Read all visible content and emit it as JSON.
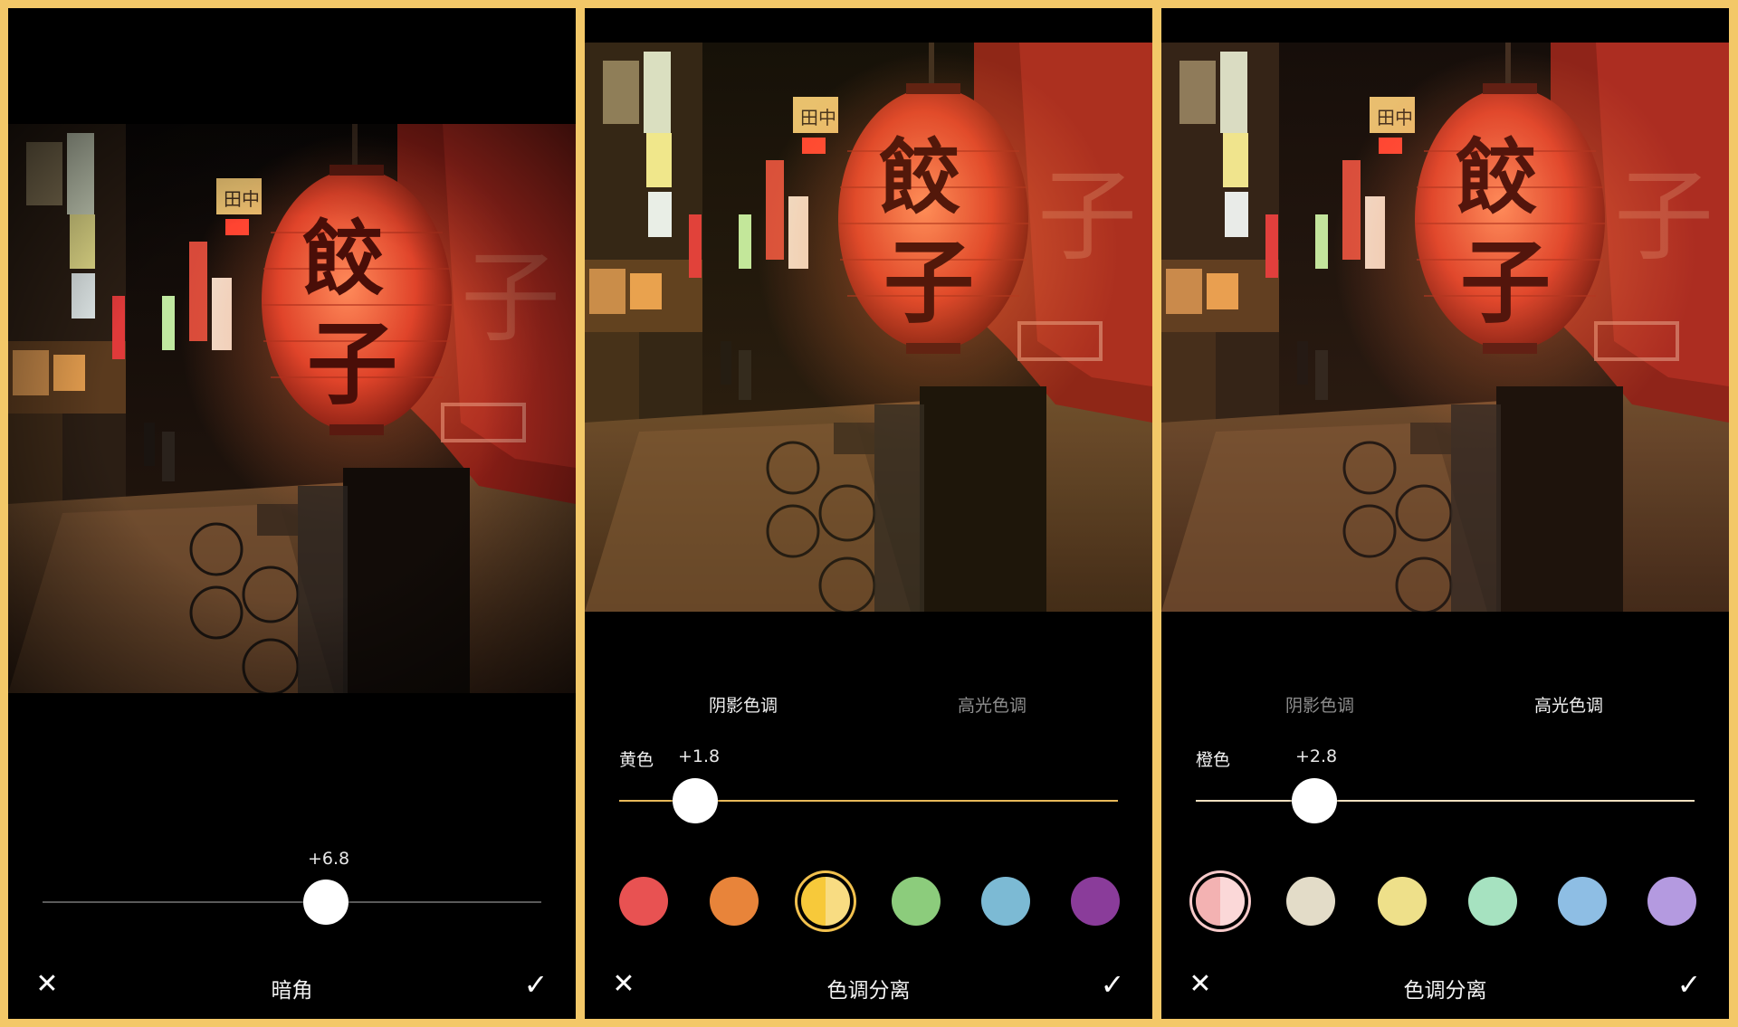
{
  "panels": [
    {
      "tool_title": "暗角",
      "value": "+6.8",
      "slider_fraction": 0.58,
      "close_icon": "✕",
      "confirm_icon": "✓"
    },
    {
      "tab_shadow": "阴影色调",
      "tab_highlight": "高光色调",
      "active_tab": "shadow",
      "color_label": "黄色",
      "value": "+1.8",
      "slider_fraction": 0.155,
      "swatches": [
        "#e85252",
        "#e8843a",
        "#f7c93a",
        "#8ccc7c",
        "#7cbad4",
        "#8a3c9a"
      ],
      "swatch_selected": 2,
      "selected_color": "#f2c14e",
      "tool_title": "色调分离",
      "close_icon": "✕",
      "confirm_icon": "✓"
    },
    {
      "tab_shadow": "阴影色调",
      "tab_highlight": "高光色调",
      "active_tab": "highlight",
      "color_label": "橙色",
      "value": "+2.8",
      "slider_fraction": 0.24,
      "swatches": [
        "#f3b2b2",
        "#e3dcc8",
        "#eee08a",
        "#a6e2c0",
        "#8ebee4",
        "#b49ae0"
      ],
      "swatch_selected": 0,
      "selected_color": "#f6c9c9",
      "tool_title": "色调分离",
      "close_icon": "✕",
      "confirm_icon": "✓"
    }
  ],
  "colors": {
    "frame": "#f3c868",
    "slider_accent": "#e8b95a",
    "slider_plain": "#8a8a8a"
  },
  "photo": {
    "lantern_text_1": "餃",
    "lantern_text_2": "子",
    "sign_text": "田中"
  }
}
